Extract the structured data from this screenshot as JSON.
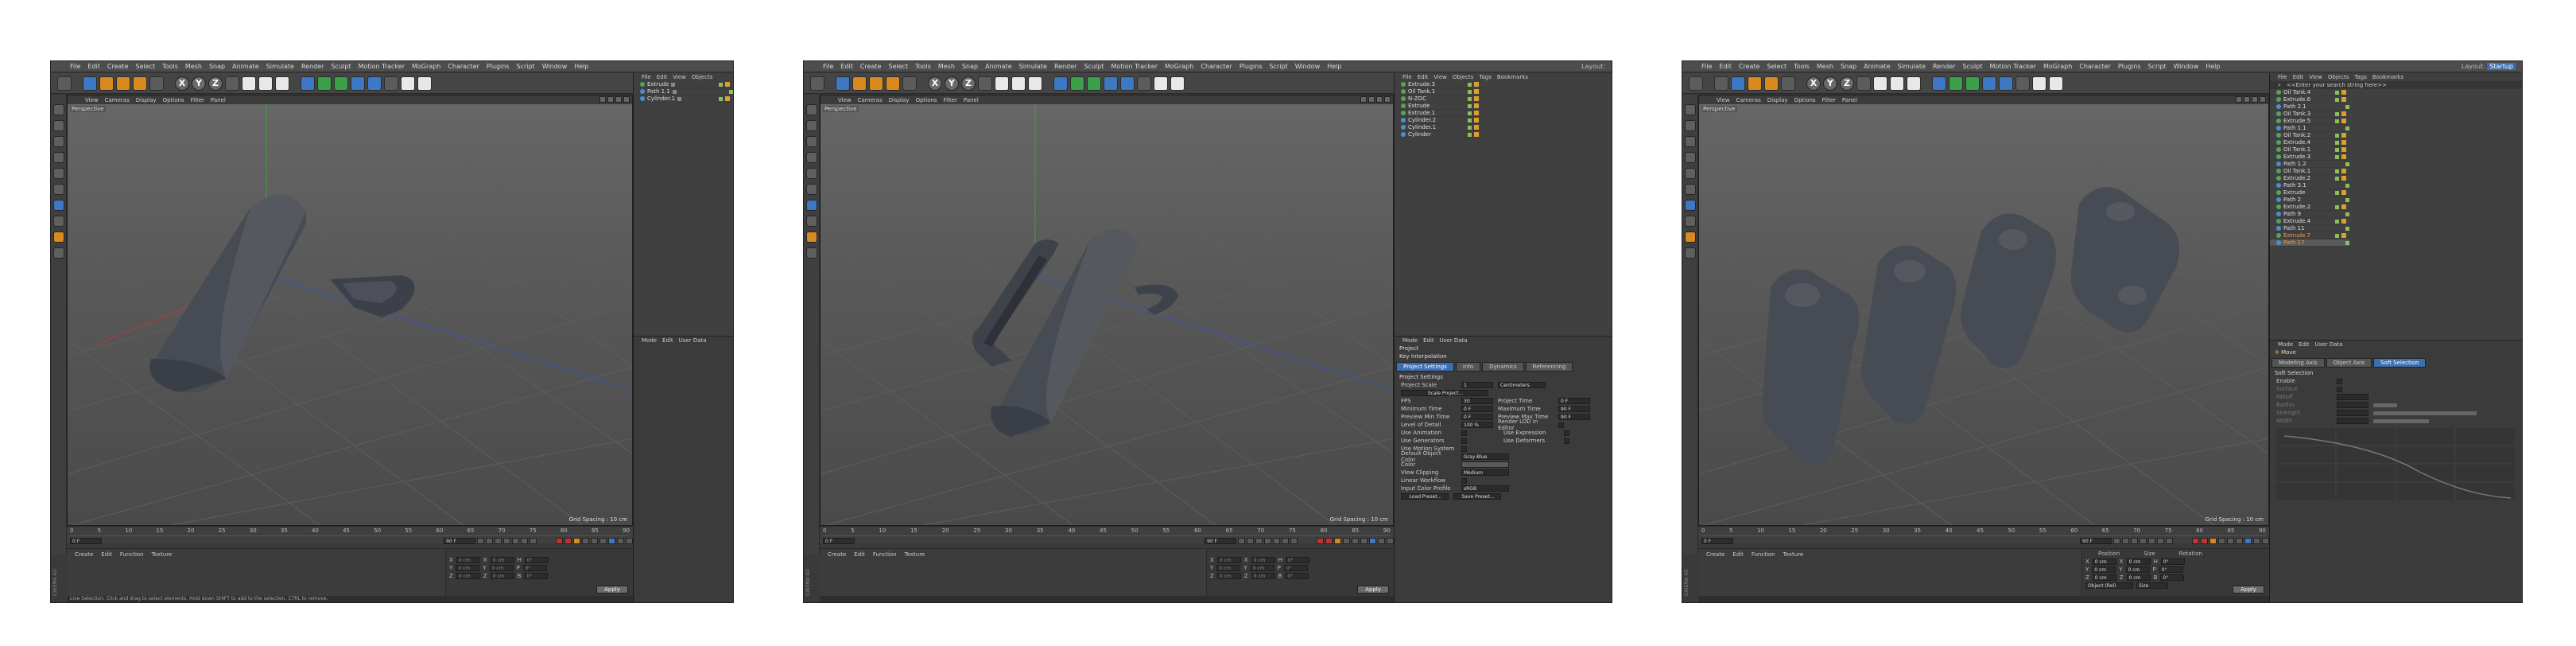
{
  "menus": [
    "File",
    "Edit",
    "Create",
    "Select",
    "Tools",
    "Mesh",
    "Snap",
    "Animate",
    "Simulate",
    "Render",
    "Sculpt",
    "Motion Tracker",
    "MoGraph",
    "Character",
    "Plugins",
    "Script",
    "Window",
    "Help"
  ],
  "viewport_menu": [
    "View",
    "Cameras",
    "Display",
    "Options",
    "Filter",
    "Panel"
  ],
  "viewport": {
    "label": "Perspective",
    "grid_spacing": "Grid Spacing : 10 cm"
  },
  "xyz": [
    "X",
    "Y",
    "Z"
  ],
  "material_menu": [
    "Create",
    "Edit",
    "Function",
    "Texture"
  ],
  "timeline": {
    "ticks": [
      "0",
      "5",
      "10",
      "15",
      "20",
      "25",
      "30",
      "35",
      "40",
      "45",
      "50",
      "55",
      "60",
      "65",
      "70",
      "75",
      "80",
      "85",
      "90"
    ],
    "start_field": "0 F",
    "end_field": "90 F",
    "current_field": "0 F"
  },
  "coords": {
    "labels": [
      "X",
      "Y",
      "Z"
    ],
    "pos_value": "0 cm",
    "rot_labels": [
      "H",
      "P",
      "B"
    ],
    "rot_value": "0°",
    "object_rel": "Object (Rel)",
    "size_mode": "Size",
    "apply": "Apply",
    "headers": [
      "Position",
      "Size",
      "Rotation"
    ]
  },
  "status": "Live Selection: Click and drag to select elements. Hold down SHIFT to add to the selection, CTRL to remove.",
  "panel_menu_short": [
    "File",
    "Edit",
    "View",
    "Objects"
  ],
  "panel_menu_long": [
    "File",
    "Edit",
    "View",
    "Objects",
    "Tags",
    "Bookmarks"
  ],
  "attr_menu": [
    "Mode",
    "Edit",
    "User Data"
  ],
  "layout_label": "Layout:",
  "layout_value": "Startup",
  "shot1": {
    "objects": [
      "Extrude",
      "Path 1.1",
      "Cylinder.1"
    ]
  },
  "shot2": {
    "objects": [
      "Extrude.3",
      "Oil Tank.1",
      "N-ZOC",
      "Extrude",
      "Extrude.1",
      "Cylinder.2",
      "Cylinder.1",
      "Cylinder"
    ],
    "project_title": "Project",
    "key_interp": "Key Interpolation",
    "tabs": [
      "Project Settings",
      "Info",
      "Dynamics",
      "Referencing"
    ],
    "section": "Project Settings",
    "settings": [
      {
        "k": "Project Scale",
        "v": "1",
        "u": "Centimeters"
      },
      {
        "k": "Scale Project...",
        "v": ""
      },
      {
        "k": "FPS",
        "v": "30",
        "k2": "Project Time",
        "v2": "0 F"
      },
      {
        "k": "Minimum Time",
        "v": "0 F",
        "k2": "Maximum Time",
        "v2": "90 F"
      },
      {
        "k": "Preview Min Time",
        "v": "0 F",
        "k2": "Preview Max Time",
        "v2": "90 F"
      },
      {
        "k": "Level of Detail",
        "v": "100 %",
        "k2": "Render LOD in Editor",
        "v2": ""
      },
      {
        "k": "Use Animation",
        "v": "",
        "k2": "Use Expression",
        "v2": ""
      },
      {
        "k": "Use Generators",
        "v": "",
        "k2": "Use Deformers",
        "v2": ""
      },
      {
        "k": "Use Motion System",
        "v": ""
      },
      {
        "k": "Default Object Color",
        "v": "Gray-Blue"
      },
      {
        "k": "Color",
        "v": ""
      },
      {
        "k": "View Clipping",
        "v": "Medium"
      },
      {
        "k": "Linear Workflow",
        "v": ""
      },
      {
        "k": "Input Color Profile",
        "v": "sRGB"
      }
    ],
    "load_preset": "Load Preset...",
    "save_preset": "Save Preset..."
  },
  "shot3": {
    "search": "<<Enter your search string here>>",
    "objects": [
      "Oil Tank.4",
      "Extrude.6",
      "Path 2.1",
      "Oil Tank.3",
      "Extrude.5",
      "Path 1.1",
      "Oil Tank.2",
      "Extrude.4",
      "Oil Tank.1",
      "Extrude.3",
      "Path 1.2",
      "Oil Tank.1",
      "Extrude.2",
      "Path 3.1",
      "Extrude",
      "Path 2",
      "Extrude.2",
      "Path 9",
      "Extrude.4",
      "Path 11",
      "Extrude.7",
      "Path 17"
    ],
    "mode_menu": [
      "Mode",
      "Edit",
      "User Data"
    ],
    "move": "Move",
    "tabs": [
      "Modeling Axis",
      "Object Axis",
      "Soft Selection"
    ],
    "section": "Soft Selection",
    "fields": [
      "Enable",
      "Surface",
      "Falloff",
      "Radius",
      "Strength",
      "Width"
    ]
  },
  "colors": {
    "accent": "#d98a1f",
    "select": "#3d6fb0",
    "bg": "#3a3a3a"
  }
}
